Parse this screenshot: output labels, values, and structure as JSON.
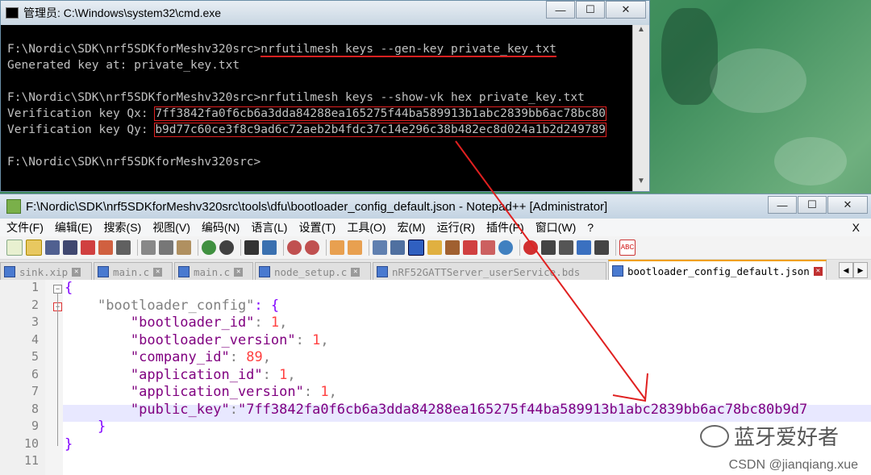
{
  "cmd": {
    "title": "管理员: C:\\Windows\\system32\\cmd.exe",
    "lines": [
      {
        "prompt": "F:\\Nordic\\SDK\\nrf5SDKforMeshv320src>",
        "cmd": "nrfutilmesh keys --gen-key private_key.txt"
      },
      {
        "text": "Generated key at: private_key.txt"
      },
      {
        "text": ""
      },
      {
        "prompt": "F:\\Nordic\\SDK\\nrf5SDKforMeshv320src>",
        "cmd": "nrfutilmesh keys --show-vk hex private_key.txt"
      },
      {
        "label": "Verification key Qx: ",
        "value": "7ff3842fa0f6cb6a3dda84288ea165275f44ba589913b1abc2839bb6ac78bc80"
      },
      {
        "label": "Verification key Qy: ",
        "value": "b9d77c60ce3f8c9ad6c72aeb2b4fdc37c14e296c38b482ec8d024a1b2d249789"
      },
      {
        "text": ""
      },
      {
        "text": "F:\\Nordic\\SDK\\nrf5SDKforMeshv320src>"
      }
    ]
  },
  "npp": {
    "title": "F:\\Nordic\\SDK\\nrf5SDKforMeshv320src\\tools\\dfu\\bootloader_config_default.json - Notepad++ [Administrator]",
    "menu": [
      "文件(F)",
      "编辑(E)",
      "搜索(S)",
      "视图(V)",
      "编码(N)",
      "语言(L)",
      "设置(T)",
      "工具(O)",
      "宏(M)",
      "运行(R)",
      "插件(P)",
      "窗口(W)",
      "?"
    ],
    "menu_close": "X",
    "tabs": [
      {
        "label": "sink.xip",
        "active": false
      },
      {
        "label": "main.c",
        "active": false
      },
      {
        "label": "main.c",
        "active": false
      },
      {
        "label": "node_setup.c",
        "active": false
      },
      {
        "label": "nRF52GATTServer_userService.bds",
        "active": false
      },
      {
        "label": "bootloader_config_default.json",
        "active": true
      }
    ],
    "lines": [
      {
        "n": "1",
        "code": "{"
      },
      {
        "n": "2",
        "key": "\"bootloader_config\"",
        "rest": ": {"
      },
      {
        "n": "3",
        "key": "\"bootloader_id\"",
        "val": "1"
      },
      {
        "n": "4",
        "key": "\"bootloader_version\"",
        "val": "1"
      },
      {
        "n": "5",
        "key": "\"company_id\"",
        "val": "89"
      },
      {
        "n": "6",
        "key": "\"application_id\"",
        "val": "1"
      },
      {
        "n": "7",
        "key": "\"application_version\"",
        "val": "1"
      },
      {
        "n": "8",
        "key": "\"public_key\"",
        "sval": "\"7ff3842fa0f6cb6a3dda84288ea165275f44ba589913b1abc2839bb6ac78bc80b9d7"
      },
      {
        "n": "9",
        "code": "}"
      },
      {
        "n": "10",
        "code": "}"
      },
      {
        "n": "11",
        "code": ""
      }
    ]
  },
  "watermark": "蓝牙爱好者",
  "csdn": "CSDN @jianqiang.xue",
  "colors": {
    "annotation_red": "#e02020"
  }
}
